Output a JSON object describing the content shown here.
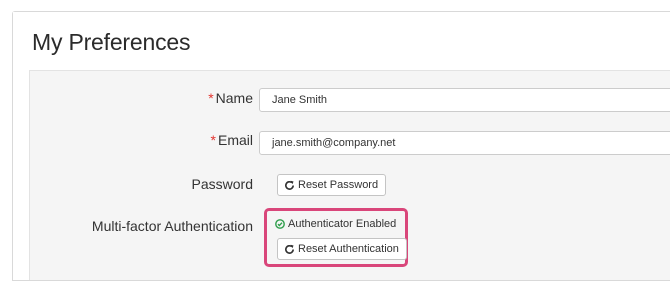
{
  "page": {
    "title": "My Preferences"
  },
  "form": {
    "name": {
      "required_marker": "*",
      "label": "Name",
      "value": "Jane Smith"
    },
    "email": {
      "required_marker": "*",
      "label": "Email",
      "value": "jane.smith@company.net"
    },
    "password": {
      "label": "Password",
      "button_label": "Reset Password",
      "button_icon": "refresh-icon"
    },
    "mfa": {
      "label": "Multi-factor Authentication",
      "status_text": "Authenticator Enabled",
      "status_icon": "check-circle-icon",
      "button_label": "Reset Authentication",
      "button_icon": "refresh-icon"
    }
  },
  "colors": {
    "required": "#e3342f",
    "highlight": "#d9467a",
    "status_ok": "#2e9e4b"
  }
}
